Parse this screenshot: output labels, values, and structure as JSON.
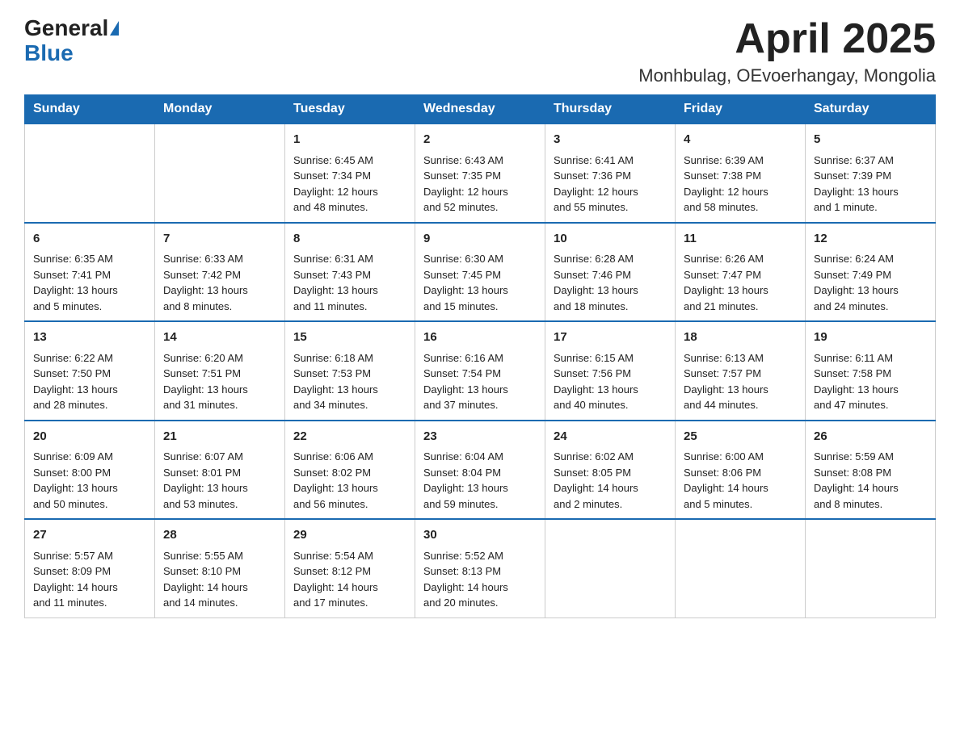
{
  "header": {
    "logo_general": "General",
    "logo_blue": "Blue",
    "title": "April 2025",
    "subtitle": "Monhbulag, OEvoerhangay, Mongolia"
  },
  "calendar": {
    "headers": [
      "Sunday",
      "Monday",
      "Tuesday",
      "Wednesday",
      "Thursday",
      "Friday",
      "Saturday"
    ],
    "weeks": [
      [
        {
          "day": "",
          "info": ""
        },
        {
          "day": "",
          "info": ""
        },
        {
          "day": "1",
          "info": "Sunrise: 6:45 AM\nSunset: 7:34 PM\nDaylight: 12 hours\nand 48 minutes."
        },
        {
          "day": "2",
          "info": "Sunrise: 6:43 AM\nSunset: 7:35 PM\nDaylight: 12 hours\nand 52 minutes."
        },
        {
          "day": "3",
          "info": "Sunrise: 6:41 AM\nSunset: 7:36 PM\nDaylight: 12 hours\nand 55 minutes."
        },
        {
          "day": "4",
          "info": "Sunrise: 6:39 AM\nSunset: 7:38 PM\nDaylight: 12 hours\nand 58 minutes."
        },
        {
          "day": "5",
          "info": "Sunrise: 6:37 AM\nSunset: 7:39 PM\nDaylight: 13 hours\nand 1 minute."
        }
      ],
      [
        {
          "day": "6",
          "info": "Sunrise: 6:35 AM\nSunset: 7:41 PM\nDaylight: 13 hours\nand 5 minutes."
        },
        {
          "day": "7",
          "info": "Sunrise: 6:33 AM\nSunset: 7:42 PM\nDaylight: 13 hours\nand 8 minutes."
        },
        {
          "day": "8",
          "info": "Sunrise: 6:31 AM\nSunset: 7:43 PM\nDaylight: 13 hours\nand 11 minutes."
        },
        {
          "day": "9",
          "info": "Sunrise: 6:30 AM\nSunset: 7:45 PM\nDaylight: 13 hours\nand 15 minutes."
        },
        {
          "day": "10",
          "info": "Sunrise: 6:28 AM\nSunset: 7:46 PM\nDaylight: 13 hours\nand 18 minutes."
        },
        {
          "day": "11",
          "info": "Sunrise: 6:26 AM\nSunset: 7:47 PM\nDaylight: 13 hours\nand 21 minutes."
        },
        {
          "day": "12",
          "info": "Sunrise: 6:24 AM\nSunset: 7:49 PM\nDaylight: 13 hours\nand 24 minutes."
        }
      ],
      [
        {
          "day": "13",
          "info": "Sunrise: 6:22 AM\nSunset: 7:50 PM\nDaylight: 13 hours\nand 28 minutes."
        },
        {
          "day": "14",
          "info": "Sunrise: 6:20 AM\nSunset: 7:51 PM\nDaylight: 13 hours\nand 31 minutes."
        },
        {
          "day": "15",
          "info": "Sunrise: 6:18 AM\nSunset: 7:53 PM\nDaylight: 13 hours\nand 34 minutes."
        },
        {
          "day": "16",
          "info": "Sunrise: 6:16 AM\nSunset: 7:54 PM\nDaylight: 13 hours\nand 37 minutes."
        },
        {
          "day": "17",
          "info": "Sunrise: 6:15 AM\nSunset: 7:56 PM\nDaylight: 13 hours\nand 40 minutes."
        },
        {
          "day": "18",
          "info": "Sunrise: 6:13 AM\nSunset: 7:57 PM\nDaylight: 13 hours\nand 44 minutes."
        },
        {
          "day": "19",
          "info": "Sunrise: 6:11 AM\nSunset: 7:58 PM\nDaylight: 13 hours\nand 47 minutes."
        }
      ],
      [
        {
          "day": "20",
          "info": "Sunrise: 6:09 AM\nSunset: 8:00 PM\nDaylight: 13 hours\nand 50 minutes."
        },
        {
          "day": "21",
          "info": "Sunrise: 6:07 AM\nSunset: 8:01 PM\nDaylight: 13 hours\nand 53 minutes."
        },
        {
          "day": "22",
          "info": "Sunrise: 6:06 AM\nSunset: 8:02 PM\nDaylight: 13 hours\nand 56 minutes."
        },
        {
          "day": "23",
          "info": "Sunrise: 6:04 AM\nSunset: 8:04 PM\nDaylight: 13 hours\nand 59 minutes."
        },
        {
          "day": "24",
          "info": "Sunrise: 6:02 AM\nSunset: 8:05 PM\nDaylight: 14 hours\nand 2 minutes."
        },
        {
          "day": "25",
          "info": "Sunrise: 6:00 AM\nSunset: 8:06 PM\nDaylight: 14 hours\nand 5 minutes."
        },
        {
          "day": "26",
          "info": "Sunrise: 5:59 AM\nSunset: 8:08 PM\nDaylight: 14 hours\nand 8 minutes."
        }
      ],
      [
        {
          "day": "27",
          "info": "Sunrise: 5:57 AM\nSunset: 8:09 PM\nDaylight: 14 hours\nand 11 minutes."
        },
        {
          "day": "28",
          "info": "Sunrise: 5:55 AM\nSunset: 8:10 PM\nDaylight: 14 hours\nand 14 minutes."
        },
        {
          "day": "29",
          "info": "Sunrise: 5:54 AM\nSunset: 8:12 PM\nDaylight: 14 hours\nand 17 minutes."
        },
        {
          "day": "30",
          "info": "Sunrise: 5:52 AM\nSunset: 8:13 PM\nDaylight: 14 hours\nand 20 minutes."
        },
        {
          "day": "",
          "info": ""
        },
        {
          "day": "",
          "info": ""
        },
        {
          "day": "",
          "info": ""
        }
      ]
    ]
  }
}
